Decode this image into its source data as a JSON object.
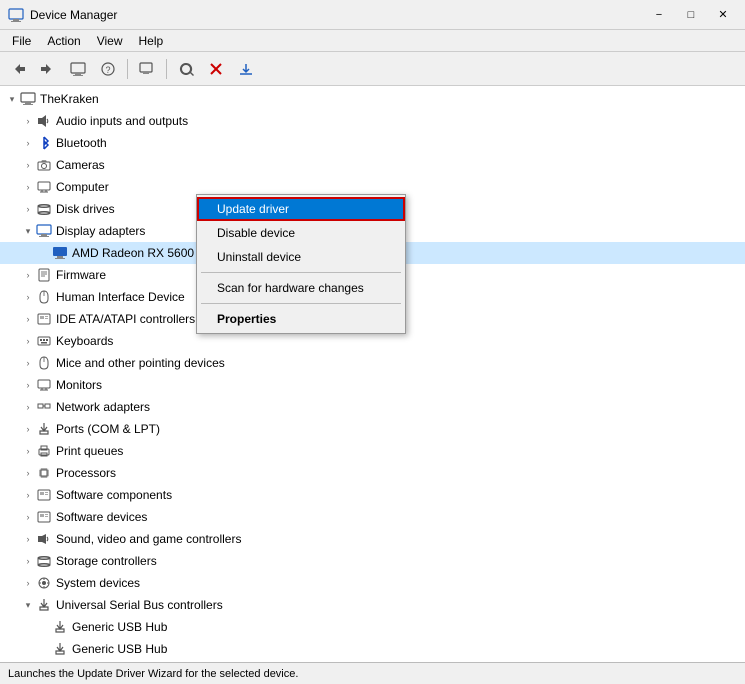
{
  "titleBar": {
    "icon": "🖥",
    "title": "Device Manager",
    "minimizeLabel": "−",
    "maximizeLabel": "□",
    "closeLabel": "✕"
  },
  "menuBar": {
    "items": [
      {
        "label": "File",
        "id": "file"
      },
      {
        "label": "Action",
        "id": "action"
      },
      {
        "label": "View",
        "id": "view"
      },
      {
        "label": "Help",
        "id": "help"
      }
    ]
  },
  "toolbar": {
    "buttons": [
      {
        "icon": "←",
        "name": "back-btn",
        "disabled": false
      },
      {
        "icon": "→",
        "name": "forward-btn",
        "disabled": false
      },
      {
        "icon": "⊞",
        "name": "show-hide-btn",
        "disabled": false
      },
      {
        "icon": "?",
        "name": "help-btn",
        "disabled": false
      },
      {
        "sep": true
      },
      {
        "icon": "⚙",
        "name": "properties-btn",
        "disabled": false
      },
      {
        "sep": true
      },
      {
        "icon": "🔄",
        "name": "scan-btn",
        "disabled": false
      },
      {
        "icon": "✕",
        "name": "uninstall-btn",
        "disabled": false
      },
      {
        "icon": "↓",
        "name": "install-btn",
        "disabled": false
      }
    ]
  },
  "tree": {
    "items": [
      {
        "id": "thekraken",
        "label": "TheKraken",
        "indent": 0,
        "toggle": "▾",
        "icon": "🖥",
        "expanded": true
      },
      {
        "id": "audio",
        "label": "Audio inputs and outputs",
        "indent": 1,
        "toggle": "›",
        "icon": "🔊",
        "expanded": false
      },
      {
        "id": "bluetooth",
        "label": "Bluetooth",
        "indent": 1,
        "toggle": "›",
        "icon": "🔵",
        "expanded": false
      },
      {
        "id": "cameras",
        "label": "Cameras",
        "indent": 1,
        "toggle": "›",
        "icon": "📷",
        "expanded": false
      },
      {
        "id": "computer",
        "label": "Computer",
        "indent": 1,
        "toggle": "›",
        "icon": "💻",
        "expanded": false
      },
      {
        "id": "disk",
        "label": "Disk drives",
        "indent": 1,
        "toggle": "›",
        "icon": "💾",
        "expanded": false
      },
      {
        "id": "display",
        "label": "Display adapters",
        "indent": 1,
        "toggle": "▾",
        "icon": "🖥",
        "expanded": true
      },
      {
        "id": "amd",
        "label": "AMD Radeon RX 5600 XT",
        "indent": 2,
        "toggle": "",
        "icon": "▣",
        "selected": true
      },
      {
        "id": "firmware",
        "label": "Firmware",
        "indent": 1,
        "toggle": "›",
        "icon": "📋",
        "expanded": false
      },
      {
        "id": "hid",
        "label": "Human Interface Device",
        "indent": 1,
        "toggle": "›",
        "icon": "🖱",
        "expanded": false
      },
      {
        "id": "ide",
        "label": "IDE ATA/ATAPI controllers",
        "indent": 1,
        "toggle": "›",
        "icon": "📦",
        "expanded": false
      },
      {
        "id": "keyboards",
        "label": "Keyboards",
        "indent": 1,
        "toggle": "›",
        "icon": "⌨",
        "expanded": false
      },
      {
        "id": "mice",
        "label": "Mice and other pointing devices",
        "indent": 1,
        "toggle": "›",
        "icon": "🖱",
        "expanded": false
      },
      {
        "id": "monitors",
        "label": "Monitors",
        "indent": 1,
        "toggle": "›",
        "icon": "🖥",
        "expanded": false
      },
      {
        "id": "network",
        "label": "Network adapters",
        "indent": 1,
        "toggle": "›",
        "icon": "🌐",
        "expanded": false
      },
      {
        "id": "ports",
        "label": "Ports (COM & LPT)",
        "indent": 1,
        "toggle": "›",
        "icon": "🔌",
        "expanded": false
      },
      {
        "id": "print",
        "label": "Print queues",
        "indent": 1,
        "toggle": "›",
        "icon": "🖨",
        "expanded": false
      },
      {
        "id": "processors",
        "label": "Processors",
        "indent": 1,
        "toggle": "›",
        "icon": "⚙",
        "expanded": false
      },
      {
        "id": "software-comp",
        "label": "Software components",
        "indent": 1,
        "toggle": "›",
        "icon": "📦",
        "expanded": false
      },
      {
        "id": "software-dev",
        "label": "Software devices",
        "indent": 1,
        "toggle": "›",
        "icon": "📦",
        "expanded": false
      },
      {
        "id": "sound",
        "label": "Sound, video and game controllers",
        "indent": 1,
        "toggle": "›",
        "icon": "🎵",
        "expanded": false
      },
      {
        "id": "storage",
        "label": "Storage controllers",
        "indent": 1,
        "toggle": "›",
        "icon": "💾",
        "expanded": false
      },
      {
        "id": "system",
        "label": "System devices",
        "indent": 1,
        "toggle": "›",
        "icon": "⚙",
        "expanded": false
      },
      {
        "id": "usb",
        "label": "Universal Serial Bus controllers",
        "indent": 1,
        "toggle": "▾",
        "icon": "🔌",
        "expanded": true
      },
      {
        "id": "usb1",
        "label": "Generic USB Hub",
        "indent": 2,
        "toggle": "",
        "icon": "🔌",
        "expanded": false
      },
      {
        "id": "usb2",
        "label": "Generic USB Hub",
        "indent": 2,
        "toggle": "",
        "icon": "🔌",
        "expanded": false
      }
    ]
  },
  "contextMenu": {
    "visible": true,
    "items": [
      {
        "id": "update-driver",
        "label": "Update driver",
        "highlighted": true
      },
      {
        "id": "disable-device",
        "label": "Disable device",
        "highlighted": false
      },
      {
        "id": "uninstall-device",
        "label": "Uninstall device",
        "highlighted": false
      },
      {
        "separator": true
      },
      {
        "id": "scan-changes",
        "label": "Scan for hardware changes",
        "highlighted": false
      },
      {
        "separator": true
      },
      {
        "id": "properties",
        "label": "Properties",
        "highlighted": false,
        "bold": true
      }
    ]
  },
  "statusBar": {
    "text": "Launches the Update Driver Wizard for the selected device."
  }
}
